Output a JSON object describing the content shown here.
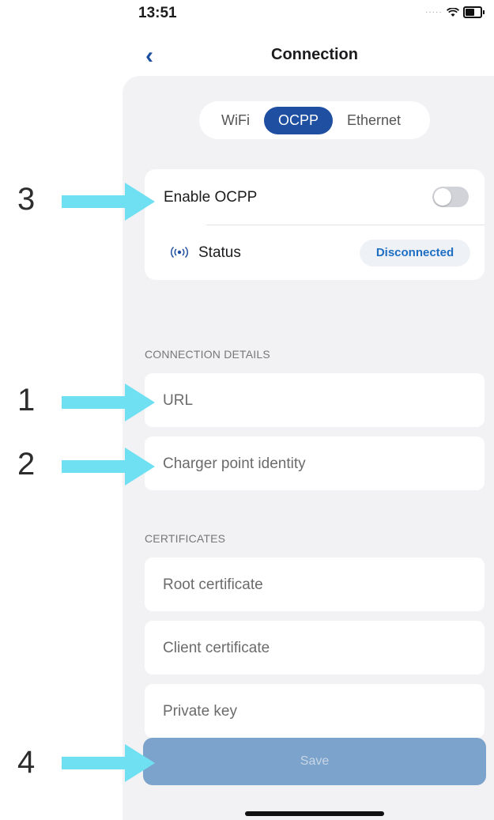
{
  "status_bar": {
    "time": "13:51",
    "signal_icon": "signal-dots-icon",
    "wifi_icon": "wifi-icon",
    "battery_icon": "battery-icon"
  },
  "nav": {
    "back_icon": "chevron-left-icon",
    "title": "Connection"
  },
  "tabs": [
    {
      "label": "WiFi",
      "active": false
    },
    {
      "label": "OCPP",
      "active": true
    },
    {
      "label": "Ethernet",
      "active": false
    }
  ],
  "ocpp": {
    "enable_label": "Enable OCPP",
    "enabled": false,
    "status_icon": "broadcast-icon",
    "status_label": "Status",
    "status_value": "Disconnected"
  },
  "connection_details": {
    "header": "CONNECTION DETAILS",
    "url_placeholder": "URL",
    "charger_id_placeholder": "Charger point identity"
  },
  "certificates": {
    "header": "CERTIFICATES",
    "root_placeholder": "Root certificate",
    "client_placeholder": "Client certificate",
    "private_key_placeholder": "Private key"
  },
  "save_label": "Save",
  "annotations": [
    {
      "number": "1",
      "target": "url-field"
    },
    {
      "number": "2",
      "target": "charger-identity-field"
    },
    {
      "number": "3",
      "target": "enable-ocpp-row"
    },
    {
      "number": "4",
      "target": "save-button"
    }
  ],
  "colors": {
    "accent": "#1e4fa0",
    "status_text": "#1e6fc2",
    "save_button": "#7ca3cb",
    "annotation_arrow": "#6fe0f2",
    "panel_bg": "#f2f2f4"
  }
}
